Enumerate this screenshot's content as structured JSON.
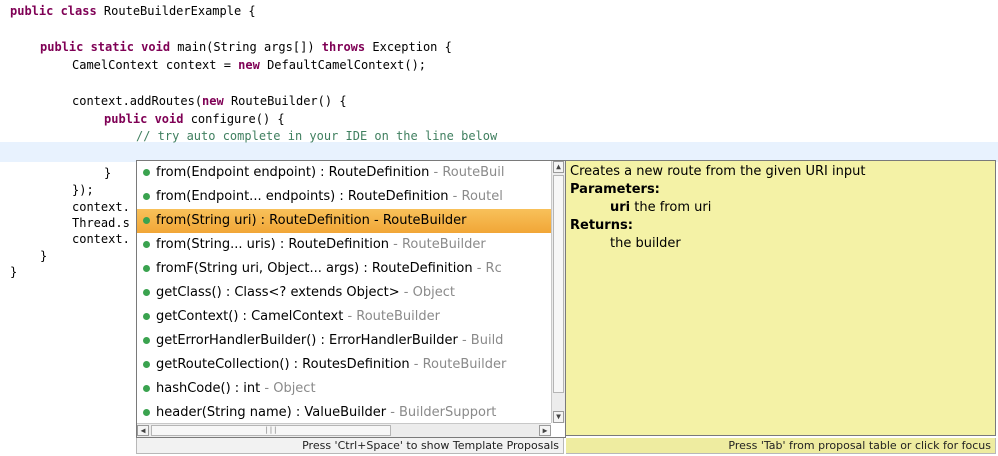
{
  "code": {
    "line1": {
      "kw": "public class ",
      "rest": "RouteBuilderExample {"
    },
    "line2": {
      "kw1": "public static void ",
      "mid": "main(String args[]) ",
      "kw2": "throws",
      "rest": " Exception {"
    },
    "line3": {
      "pre": "CamelContext context = ",
      "kw": "new",
      "rest": " DefaultCamelContext();"
    },
    "line4": {
      "pre": "context.addRoutes(",
      "kw": "new",
      "rest": " RouteBuilder() {"
    },
    "line5": {
      "kw": "public void ",
      "rest": "configure() {"
    },
    "line6": "// try auto complete in your IDE on the line below",
    "line7": "}",
    "line8": "});",
    "line9": "context.",
    "line10": "Thread.s",
    "line11": "context.",
    "line12": "}",
    "line13": "}"
  },
  "proposals": [
    {
      "main": "from(Endpoint endpoint) : RouteDefinition",
      "suffix": " - RouteBuil",
      "selected": false
    },
    {
      "main": "from(Endpoint... endpoints) : RouteDefinition",
      "suffix": " - Routel",
      "selected": false
    },
    {
      "main": "from(String uri) : RouteDefinition",
      "suffix": " - RouteBuilder",
      "selected": true
    },
    {
      "main": "from(String... uris) : RouteDefinition",
      "suffix": " - RouteBuilder",
      "selected": false
    },
    {
      "main": "fromF(String uri, Object... args) : RouteDefinition",
      "suffix": " - Rc",
      "selected": false
    },
    {
      "main": "getClass() : Class<? extends Object>",
      "suffix": " - Object",
      "selected": false
    },
    {
      "main": "getContext() : CamelContext",
      "suffix": " - RouteBuilder",
      "selected": false
    },
    {
      "main": "getErrorHandlerBuilder() : ErrorHandlerBuilder",
      "suffix": " - Build",
      "selected": false
    },
    {
      "main": "getRouteCollection() : RoutesDefinition",
      "suffix": " - RouteBuilder",
      "selected": false
    },
    {
      "main": "hashCode() : int",
      "suffix": " - Object",
      "selected": false
    },
    {
      "main": "header(String name) : ValueBuilder",
      "suffix": " - BuilderSupport",
      "selected": false
    }
  ],
  "icons": {
    "proposal": "method-icon",
    "scroll_up": "arrow-up-icon",
    "scroll_down": "arrow-down-icon",
    "scroll_left": "arrow-left-icon",
    "scroll_right": "arrow-right-icon"
  },
  "doc": {
    "summary": "Creates a new route from the given URI input",
    "parameters_label": "Parameters:",
    "param_name": "uri",
    "param_desc": " the from uri",
    "returns_label": "Returns:",
    "returns_desc": "the builder"
  },
  "status": {
    "left": "Press 'Ctrl+Space' to show Template Proposals",
    "right": "Press 'Tab' from proposal table or click for focus"
  },
  "colors": {
    "selection": "#f1a637",
    "doc_background": "#f4f2a6",
    "method_dot": "#3aa34f",
    "keyword": "#7f0055",
    "comment": "#3f7f5f"
  }
}
